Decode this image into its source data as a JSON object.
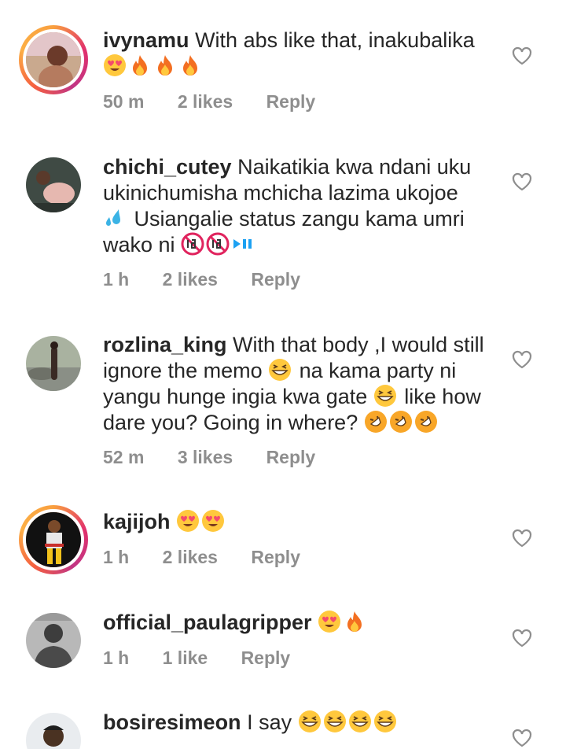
{
  "comments": [
    {
      "user": "ivynamu",
      "text": "With abs like that, inakubalika",
      "emoji_line": [
        "heart-eyes",
        "fire",
        "fire",
        "fire"
      ],
      "time": "50 m",
      "likes": "2 likes",
      "reply": "Reply",
      "ring": true
    },
    {
      "user": "chichi_cutey",
      "text_l1": "Naikatikia kwa ndani uku",
      "text_l2": "ukinichumisha mchicha lazima ukojoe",
      "text_l3": "Usiangalie status zangu kama umri",
      "text_l4": "wako ni",
      "time": "1 h",
      "likes": "2 likes",
      "reply": "Reply",
      "ring": false
    },
    {
      "user": "rozlina_king",
      "text_l1": "With that body ,I would still",
      "text_l2a": "ignore the memo",
      "text_l2b": "na kama party ni",
      "text_l3a": "yangu hunge ingia kwa gate",
      "text_l3b": "like how",
      "text_l4": "dare you? Going in where?",
      "time": "52 m",
      "likes": "3 likes",
      "reply": "Reply",
      "ring": false
    },
    {
      "user": "kajijoh",
      "time": "1 h",
      "likes": "2 likes",
      "reply": "Reply",
      "ring": true
    },
    {
      "user": "official_paulagripper",
      "time": "1 h",
      "likes": "1 like",
      "reply": "Reply",
      "ring": false
    },
    {
      "user": "bosiresimeon",
      "text": "I say",
      "ring": false
    }
  ],
  "colors": {
    "meta": "#8e8e8e",
    "text": "#262626"
  },
  "icons": {
    "like": "heart-outline-icon"
  }
}
